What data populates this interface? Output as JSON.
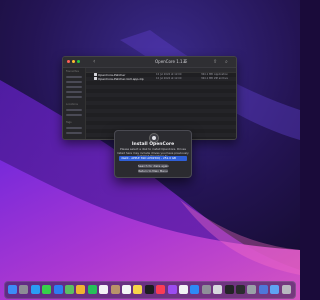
{
  "finder": {
    "title": "OpenCore 1.1.0",
    "sidebar": {
      "sections": [
        "Favourites",
        "Locations",
        "Tags"
      ]
    },
    "files": [
      {
        "name": "OpenCore-Patcher",
        "date": "10 Jul 2024 at 12:00",
        "size": "364.1 MB",
        "kind": "Application"
      },
      {
        "name": "OpenCore-Patcher-GUI.app.zip",
        "date": "10 Jul 2024 at 12:00",
        "size": "364.1 MB",
        "kind": "ZIP archive"
      }
    ]
  },
  "installer": {
    "title": "Install OpenCore",
    "message": "Please select a disk to install OpenCore. Drives listed here may include drives you have previously installed OpenCore to.",
    "selected_disk": "disk0 - APPLE SSD AP0256Q - 251.0 GB",
    "buttons": [
      "Search for disks again",
      "Return to Main Menu"
    ]
  },
  "dock": {
    "apps": [
      {
        "name": "finder",
        "color": "#3d8bf7"
      },
      {
        "name": "launchpad",
        "color": "#8d8d96"
      },
      {
        "name": "safari",
        "color": "#2a9df4"
      },
      {
        "name": "messages",
        "color": "#37d04b"
      },
      {
        "name": "mail",
        "color": "#2d7cf3"
      },
      {
        "name": "maps",
        "color": "#5bbf63"
      },
      {
        "name": "photos",
        "color": "#f2b232"
      },
      {
        "name": "facetime",
        "color": "#26c05a"
      },
      {
        "name": "calendar",
        "color": "#f3f3f5"
      },
      {
        "name": "contacts",
        "color": "#b9936a"
      },
      {
        "name": "reminders",
        "color": "#f4f4f7"
      },
      {
        "name": "notes",
        "color": "#f7d54a"
      },
      {
        "name": "tv",
        "color": "#1c1c1f"
      },
      {
        "name": "music",
        "color": "#fb3c55"
      },
      {
        "name": "podcasts",
        "color": "#9b4cf0"
      },
      {
        "name": "news",
        "color": "#f2f2f4"
      },
      {
        "name": "app-store",
        "color": "#2e8af7"
      },
      {
        "name": "system-settings",
        "color": "#8f8f99"
      },
      {
        "name": "preview",
        "color": "#d8d8de"
      },
      {
        "name": "terminal",
        "color": "#232326"
      },
      {
        "name": "activity-monitor",
        "color": "#2c2c2f"
      },
      {
        "name": "disk-utility",
        "color": "#9aa0a8"
      },
      {
        "name": "opencore-patcher",
        "color": "#4f77d9"
      },
      {
        "name": "folder",
        "color": "#5fa4f3"
      },
      {
        "name": "trash",
        "color": "#b8b8c0"
      }
    ]
  }
}
